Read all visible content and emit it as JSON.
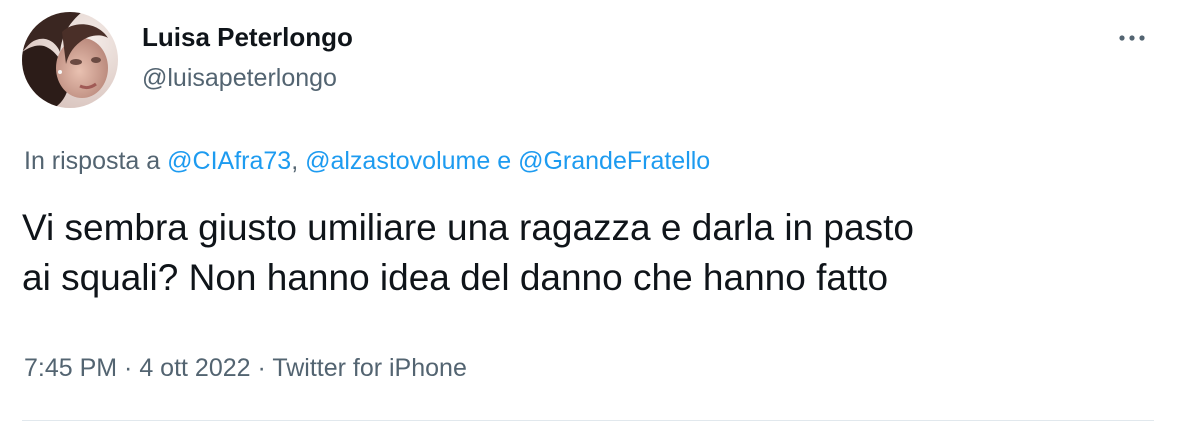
{
  "author": {
    "display_name": "Luisa Peterlongo",
    "handle": "@luisapeterlongo"
  },
  "more_icon": "more-horizontal-icon",
  "reply": {
    "prefix": "In risposta a ",
    "mentions": [
      "@CIAfra73",
      "@alzastovolume",
      "@GrandeFratello"
    ],
    "separator": ", ",
    "conjunction": " e "
  },
  "tweet": {
    "lines": [
      "Vi sembra giusto umiliare una ragazza e darla in pasto",
      "ai squali? Non hanno idea del danno che hanno fatto"
    ]
  },
  "meta": {
    "time": "7:45 PM",
    "dot": " · ",
    "date": "4 ott 2022",
    "source": "Twitter for iPhone"
  },
  "colors": {
    "text": "#0f1419",
    "secondary": "#536471",
    "link": "#1d9bf0",
    "divider": "#e1e8ed"
  }
}
